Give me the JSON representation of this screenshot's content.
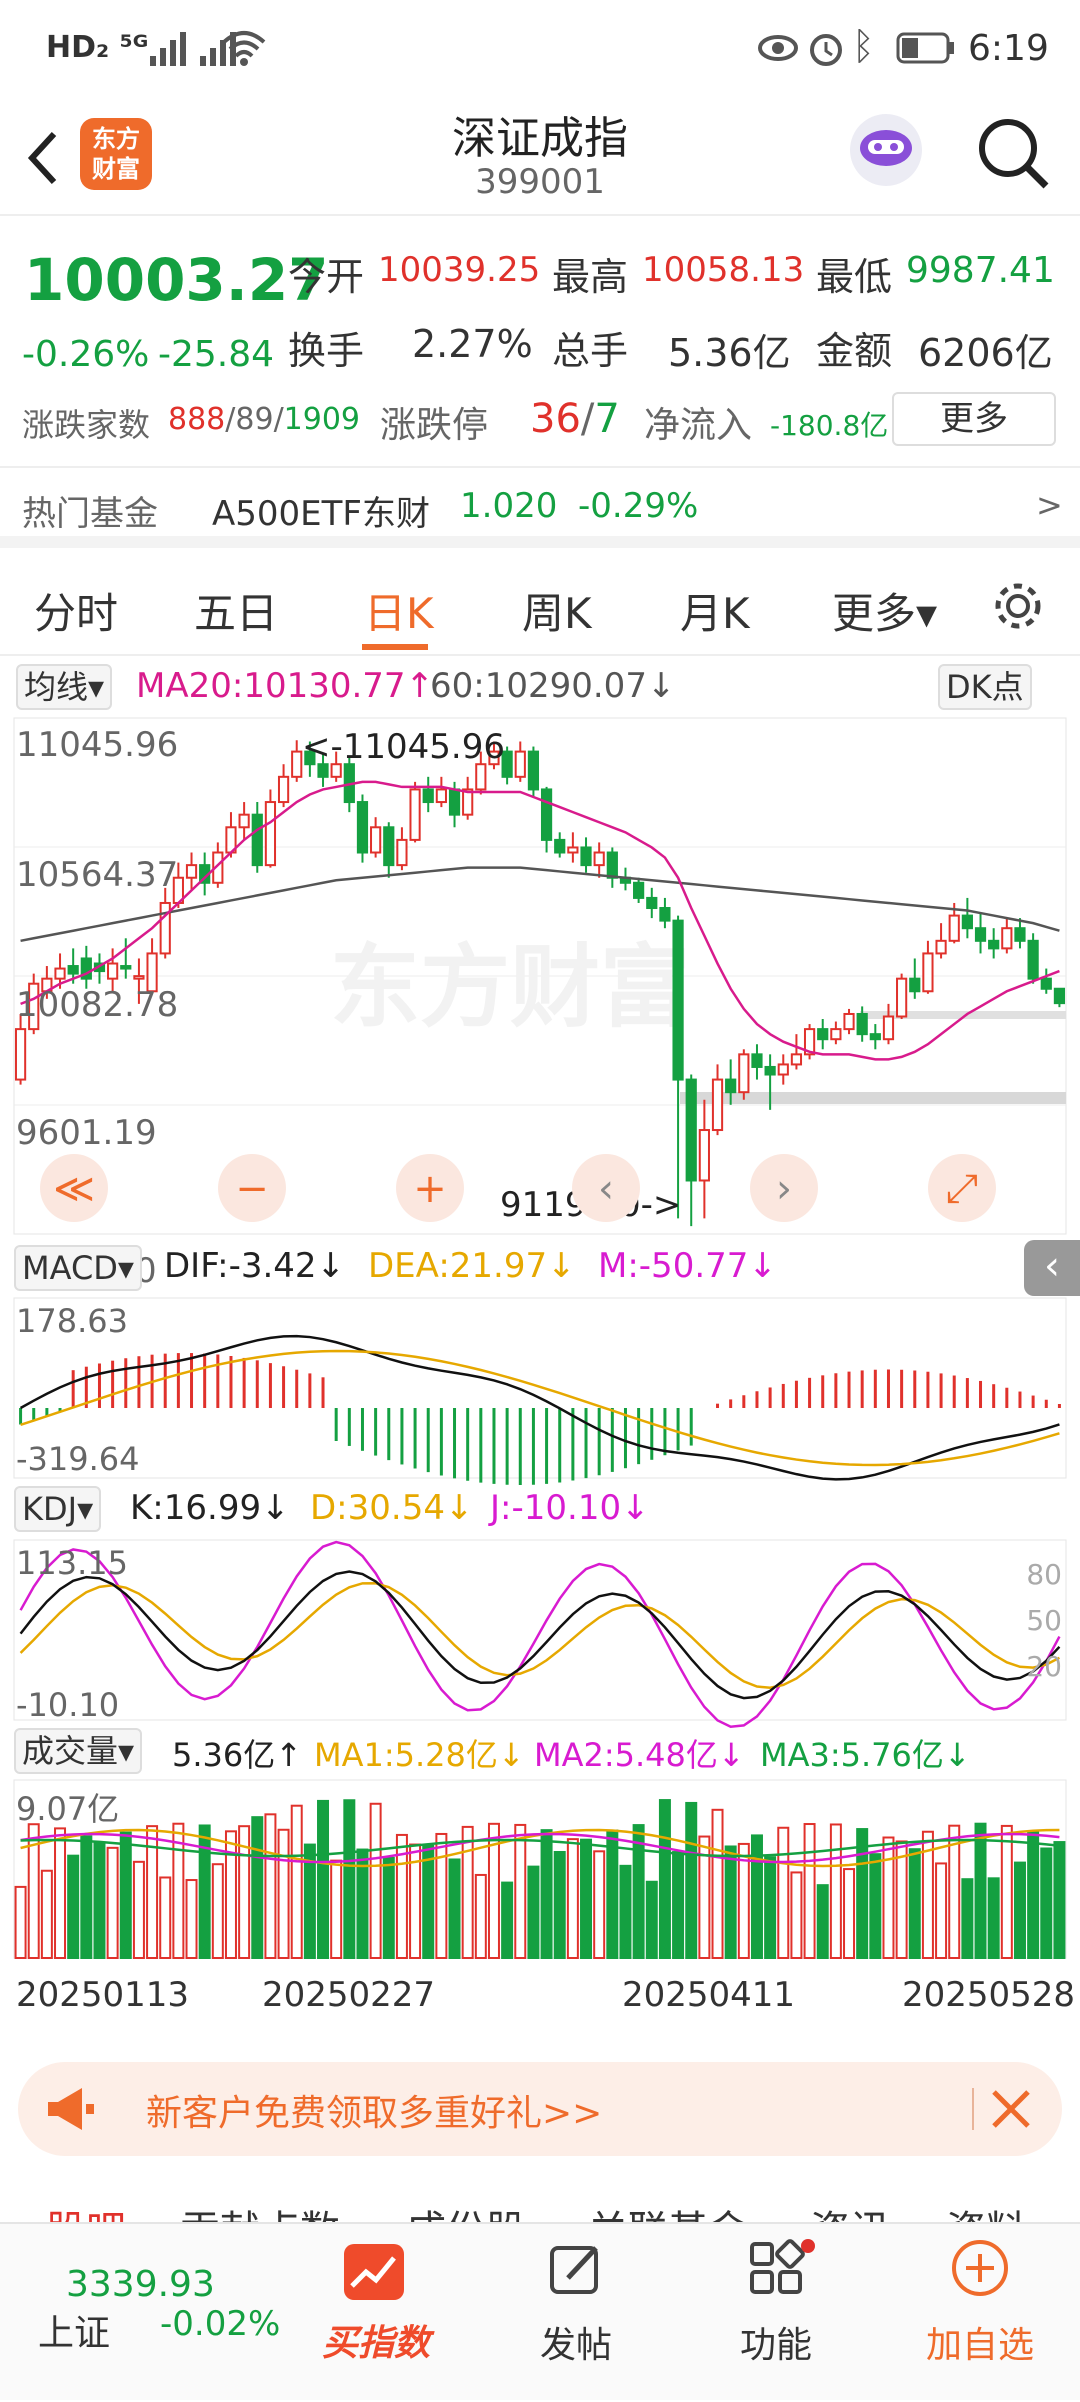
{
  "status_bar": {
    "left": "HD₂  ⁵ᴳ",
    "time": "6:19"
  },
  "header": {
    "title": "深证成指",
    "code": "399001",
    "logo": "东方\n财富"
  },
  "quote": {
    "price": "10003.27",
    "change_pct": "-0.26%",
    "change": "-25.84",
    "open_label": "今开",
    "open": "10039.25",
    "high_label": "最高",
    "high": "10058.13",
    "low_label": "最低",
    "low": "9987.41",
    "turnover_label": "换手",
    "turnover": "2.27%",
    "volume_label": "总手",
    "volume": "5.36亿",
    "amount_label": "金额",
    "amount": "6206亿",
    "breadth_label": "涨跌家数",
    "up": "888",
    "flat": "89",
    "down": "1909",
    "limit_label": "涨跌停",
    "limit_up": "36",
    "limit_down": "7",
    "inflow_label": "净流入",
    "inflow": "-180.8亿",
    "more": "更多"
  },
  "hot_fund": {
    "label": "热门基金",
    "name": "A500ETF东财",
    "price": "1.020",
    "pct": "-0.29%",
    "arrow": ">"
  },
  "tabs": [
    "分时",
    "五日",
    "日K",
    "周K",
    "月K",
    "更多▾"
  ],
  "tabs_active": 2,
  "kline": {
    "selector": "均线▾",
    "ma20": "MA20:10130.77↑",
    "ma60": "60:10290.07↓",
    "dk": "DK点",
    "y_labels": [
      "11045.96",
      "10564.37",
      "10082.78",
      "9601.19",
      "9119.60"
    ],
    "high_mark": "<-11045.96",
    "low_mark": "9119.60->",
    "watermark": "东方财富",
    "controls": [
      "≪",
      "−",
      "+",
      "‹",
      "›",
      "⤢"
    ]
  },
  "macd": {
    "selector": "MACD▾",
    "dif": "DIF:-3.42↓",
    "dea": "DEA:21.97↓",
    "m": "M:-50.77↓",
    "max": "178.63",
    "min": "-319.64"
  },
  "kdj": {
    "selector": "KDJ▾",
    "k": "K:16.99↓",
    "d": "D:30.54↓",
    "j": "J:-10.10↓",
    "max": "113.15",
    "min": "-10.10",
    "levels": [
      "80",
      "50",
      "20"
    ]
  },
  "vol": {
    "selector": "成交量▾",
    "v": "5.36亿↑",
    "ma1": "MA1:5.28亿↓",
    "ma2": "MA2:5.48亿↓",
    "ma3": "MA3:5.76亿↓",
    "max": "9.07亿"
  },
  "dates": [
    "20250113",
    "20250227",
    "20250411",
    "20250528"
  ],
  "promo": {
    "text": "新客户免费领取多重好礼>>"
  },
  "sub_tabs": [
    "股吧",
    "贡献点数",
    "成份股",
    "关联基金",
    "资讯",
    "资料"
  ],
  "bottom_nav": {
    "index_value": "3339.93",
    "index_name": "上证",
    "index_pct": "-0.02%",
    "items": [
      "买指数",
      "发帖",
      "功能",
      "加自选"
    ]
  },
  "colors": {
    "up": "#e0312b",
    "down": "#14a041",
    "ma20": "#d81b8c",
    "ma60": "#555555",
    "accent": "#ef6b2b"
  },
  "chart_data": {
    "type": "candlestick",
    "ylim": [
      9119.6,
      11045.96
    ],
    "candles": [
      [
        9700,
        9900,
        9680,
        9960
      ],
      [
        9900,
        10080,
        9880,
        10120
      ],
      [
        10050,
        10100,
        10020,
        10150
      ],
      [
        10100,
        10140,
        10060,
        10200
      ],
      [
        10150,
        10120,
        10080,
        10220
      ],
      [
        10180,
        10100,
        10060,
        10230
      ],
      [
        10160,
        10130,
        10080,
        10200
      ],
      [
        10100,
        10160,
        10050,
        10220
      ],
      [
        10150,
        10140,
        10100,
        10260
      ],
      [
        10100,
        10110,
        10000,
        10180
      ],
      [
        10050,
        10200,
        10040,
        10260
      ],
      [
        10200,
        10400,
        10180,
        10460
      ],
      [
        10400,
        10500,
        10380,
        10560
      ],
      [
        10500,
        10550,
        10450,
        10600
      ],
      [
        10550,
        10480,
        10430,
        10600
      ],
      [
        10480,
        10600,
        10460,
        10640
      ],
      [
        10600,
        10700,
        10580,
        10760
      ],
      [
        10700,
        10750,
        10650,
        10800
      ],
      [
        10750,
        10550,
        10520,
        10800
      ],
      [
        10550,
        10800,
        10540,
        10850
      ],
      [
        10800,
        10900,
        10780,
        10950
      ],
      [
        10900,
        11000,
        10880,
        11045
      ],
      [
        11000,
        10950,
        10900,
        11040
      ],
      [
        10950,
        10900,
        10860,
        10990
      ],
      [
        10900,
        10950,
        10880,
        11000
      ],
      [
        10950,
        10800,
        10760,
        10980
      ],
      [
        10800,
        10600,
        10560,
        10830
      ],
      [
        10600,
        10700,
        10580,
        10740
      ],
      [
        10700,
        10550,
        10500,
        10720
      ],
      [
        10550,
        10650,
        10530,
        10700
      ],
      [
        10650,
        10850,
        10640,
        10880
      ],
      [
        10850,
        10800,
        10760,
        10900
      ],
      [
        10800,
        10850,
        10780,
        10900
      ],
      [
        10850,
        10750,
        10700,
        10880
      ],
      [
        10750,
        10850,
        10730,
        10900
      ],
      [
        10850,
        10950,
        10830,
        11000
      ],
      [
        10950,
        11000,
        10930,
        11040
      ],
      [
        11000,
        10900,
        10870,
        11020
      ],
      [
        10900,
        11000,
        10880,
        11040
      ],
      [
        11000,
        10850,
        10820,
        11020
      ],
      [
        10850,
        10650,
        10600,
        10860
      ],
      [
        10650,
        10600,
        10580,
        10680
      ],
      [
        10600,
        10620,
        10560,
        10680
      ],
      [
        10620,
        10550,
        10520,
        10660
      ],
      [
        10550,
        10600,
        10500,
        10640
      ],
      [
        10600,
        10500,
        10460,
        10620
      ],
      [
        10500,
        10480,
        10450,
        10540
      ],
      [
        10480,
        10420,
        10400,
        10500
      ],
      [
        10420,
        10380,
        10340,
        10460
      ],
      [
        10380,
        10330,
        10300,
        10420
      ],
      [
        10330,
        9700,
        9150,
        10350
      ],
      [
        9700,
        9300,
        9119,
        9720
      ],
      [
        9300,
        9500,
        9150,
        9620
      ],
      [
        9500,
        9700,
        9480,
        9760
      ],
      [
        9700,
        9650,
        9600,
        9780
      ],
      [
        9650,
        9800,
        9620,
        9820
      ],
      [
        9800,
        9750,
        9700,
        9840
      ],
      [
        9750,
        9720,
        9580,
        9800
      ],
      [
        9720,
        9760,
        9680,
        9800
      ],
      [
        9760,
        9800,
        9740,
        9880
      ],
      [
        9800,
        9900,
        9780,
        9920
      ],
      [
        9900,
        9860,
        9820,
        9940
      ],
      [
        9860,
        9900,
        9840,
        9930
      ],
      [
        9900,
        9960,
        9880,
        9980
      ],
      [
        9960,
        9880,
        9850,
        9990
      ],
      [
        9880,
        9860,
        9820,
        9920
      ],
      [
        9860,
        9950,
        9840,
        10000
      ],
      [
        9950,
        10100,
        9940,
        10120
      ],
      [
        10100,
        10050,
        10020,
        10180
      ],
      [
        10050,
        10200,
        10040,
        10250
      ],
      [
        10200,
        10250,
        10180,
        10320
      ],
      [
        10250,
        10350,
        10240,
        10400
      ],
      [
        10350,
        10300,
        10260,
        10420
      ],
      [
        10300,
        10250,
        10200,
        10360
      ],
      [
        10250,
        10220,
        10180,
        10300
      ],
      [
        10220,
        10300,
        10200,
        10340
      ],
      [
        10300,
        10250,
        10220,
        10340
      ],
      [
        10250,
        10100,
        10080,
        10280
      ],
      [
        10100,
        10060,
        10040,
        10140
      ],
      [
        10060,
        10003,
        9987,
        10058
      ]
    ],
    "ma20": [
      10000,
      10020,
      10050,
      10080,
      10100,
      10120,
      10150,
      10180,
      10220,
      10260,
      10300,
      10350,
      10400,
      10450,
      10500,
      10550,
      10600,
      10650,
      10690,
      10720,
      10760,
      10800,
      10830,
      10850,
      10860,
      10870,
      10880,
      10880,
      10870,
      10860,
      10860,
      10860,
      10860,
      10850,
      10840,
      10840,
      10840,
      10840,
      10840,
      10820,
      10800,
      10780,
      10760,
      10740,
      10720,
      10700,
      10680,
      10650,
      10620,
      10580,
      10500,
      10380,
      10270,
      10160,
      10060,
      9980,
      9920,
      9880,
      9850,
      9830,
      9810,
      9800,
      9800,
      9800,
      9790,
      9780,
      9780,
      9790,
      9810,
      9840,
      9880,
      9920,
      9960,
      9990,
      10020,
      10050,
      10070,
      10090,
      10110,
      10130
    ],
    "ma60": [
      10250,
      10260,
      10270,
      10280,
      10290,
      10300,
      10310,
      10320,
      10330,
      10340,
      10350,
      10360,
      10370,
      10380,
      10390,
      10400,
      10410,
      10420,
      10430,
      10440,
      10450,
      10460,
      10470,
      10480,
      10490,
      10495,
      10500,
      10505,
      10510,
      10515,
      10520,
      10525,
      10530,
      10535,
      10540,
      10540,
      10540,
      10540,
      10540,
      10535,
      10530,
      10525,
      10520,
      10515,
      10510,
      10505,
      10500,
      10495,
      10490,
      10485,
      10480,
      10475,
      10470,
      10465,
      10460,
      10455,
      10450,
      10445,
      10440,
      10435,
      10430,
      10425,
      10420,
      10415,
      10410,
      10405,
      10400,
      10395,
      10390,
      10385,
      10380,
      10375,
      10370,
      10360,
      10350,
      10340,
      10330,
      10320,
      10305,
      10290
    ]
  }
}
